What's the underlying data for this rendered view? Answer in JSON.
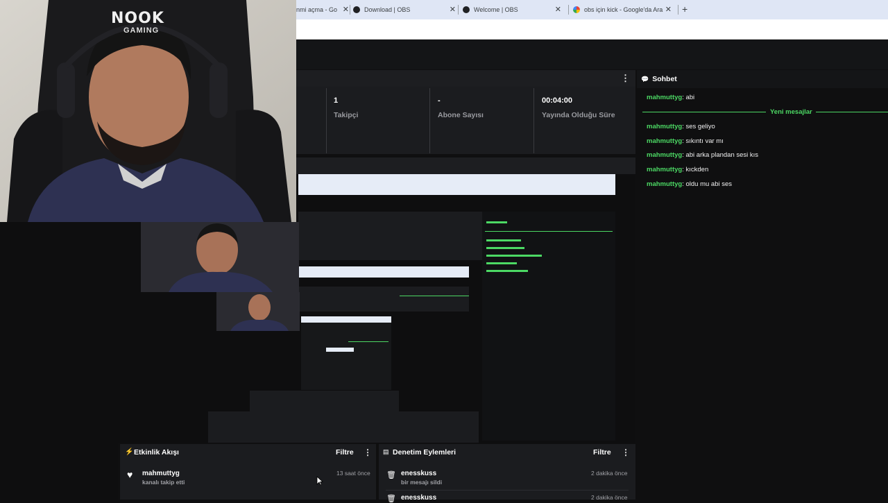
{
  "browser": {
    "tabs": [
      {
        "title": "nmi açma - Go",
        "close": "✕",
        "favicon_color": "#4285f4"
      },
      {
        "title": "Download | OBS",
        "close": "✕",
        "favicon_color": "#202124"
      },
      {
        "title": "Welcome | OBS",
        "close": "✕",
        "favicon_color": "#202124"
      },
      {
        "title": "obs için kick - Google'da Ara",
        "close": "✕",
        "favicon_color": "#ea4335"
      }
    ],
    "new_tab": "+"
  },
  "stats": [
    {
      "value": "1",
      "label": "Takipçi"
    },
    {
      "value": "-",
      "label": "Abone Sayısı"
    },
    {
      "value": "00:04:00",
      "label": "Yayında Olduğu Süre"
    }
  ],
  "chat": {
    "title": "Sohbet",
    "messages_before": [
      {
        "user": "mahmuttyg",
        "text": ": abi"
      }
    ],
    "divider": "Yeni mesajlar",
    "messages_after": [
      {
        "user": "mahmuttyg",
        "text": ": ses geliyo"
      },
      {
        "user": "mahmuttyg",
        "text": ": sıkıntı var mı"
      },
      {
        "user": "mahmuttyg",
        "text": ": abi arka plandan sesi kıs"
      },
      {
        "user": "mahmuttyg",
        "text": ": kıckden"
      },
      {
        "user": "mahmuttyg",
        "text": ": oldu mu abi ses"
      }
    ]
  },
  "activity": {
    "title": "Etkinlik Akışı",
    "filter": "Filtre",
    "items": [
      {
        "name": "mahmuttyg",
        "sub": "kanalı takip etti",
        "time": "13 saat önce"
      }
    ]
  },
  "moderation": {
    "title": "Denetim Eylemleri",
    "filter": "Filtre",
    "items": [
      {
        "name": "enesskuss",
        "sub": "bir mesajı sildi",
        "time": "2 dakika önce"
      },
      {
        "name": "enesskuss",
        "sub": "",
        "time": "2 dakika önce"
      }
    ]
  },
  "webcam": {
    "chair_text_1": "NOOK",
    "chair_text_2": "GAMING"
  },
  "colors": {
    "accent_green": "#4cd964",
    "panel_bg": "#1b1c1f",
    "page_bg": "#0f0f10"
  }
}
